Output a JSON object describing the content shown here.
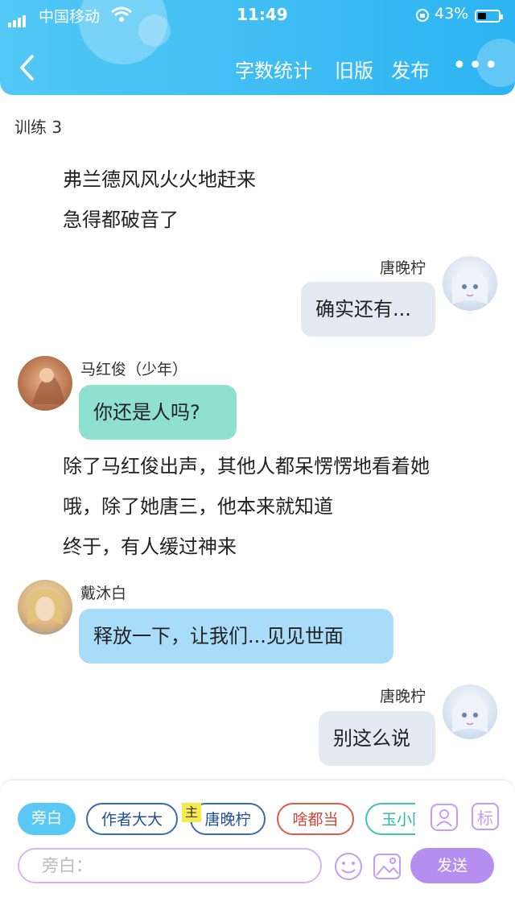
{
  "status_bar": {
    "carrier": "中国移动",
    "time": "11:49",
    "battery": "43%",
    "battery_level": 0.43
  },
  "nav": {
    "word_count": "字数统计",
    "old_version": "旧版",
    "publish": "发布",
    "more": "•••",
    "back": "‹"
  },
  "subtitle": "训练 3",
  "messages": {
    "narr1": [
      "弗兰德风风火火地赶来",
      "急得都破音了"
    ],
    "m1": {
      "name": "唐晚柠",
      "text": "确实还有..."
    },
    "m2": {
      "name": "马红俊（少年）",
      "text": "你还是人吗?"
    },
    "narr2": [
      "除了马红俊出声，其他人都呆愣愣地看着她",
      "哦，除了她唐三，他本来就知道",
      "终于，有人缓过神来"
    ],
    "m3": {
      "name": "戴沐白",
      "text": "释放一下，让我们...见见世面"
    },
    "m4": {
      "name": "唐晚柠",
      "text": "别这么说"
    }
  },
  "roles": {
    "narrator": "旁白",
    "author": "作者大大",
    "main_badge": "主",
    "tang": "唐晚柠",
    "whatever": "啥都当",
    "yu": "玉小刚"
  },
  "input": {
    "placeholder": "旁白：",
    "send": "发送",
    "tag": "标"
  },
  "colors": {
    "header": "#2db4f2",
    "narration_bubble": "#a8dcf8",
    "teal_bubble": "#8fe0d0",
    "self_bubble": "#e3e9f0",
    "accent_purple": "#b58ef0"
  }
}
